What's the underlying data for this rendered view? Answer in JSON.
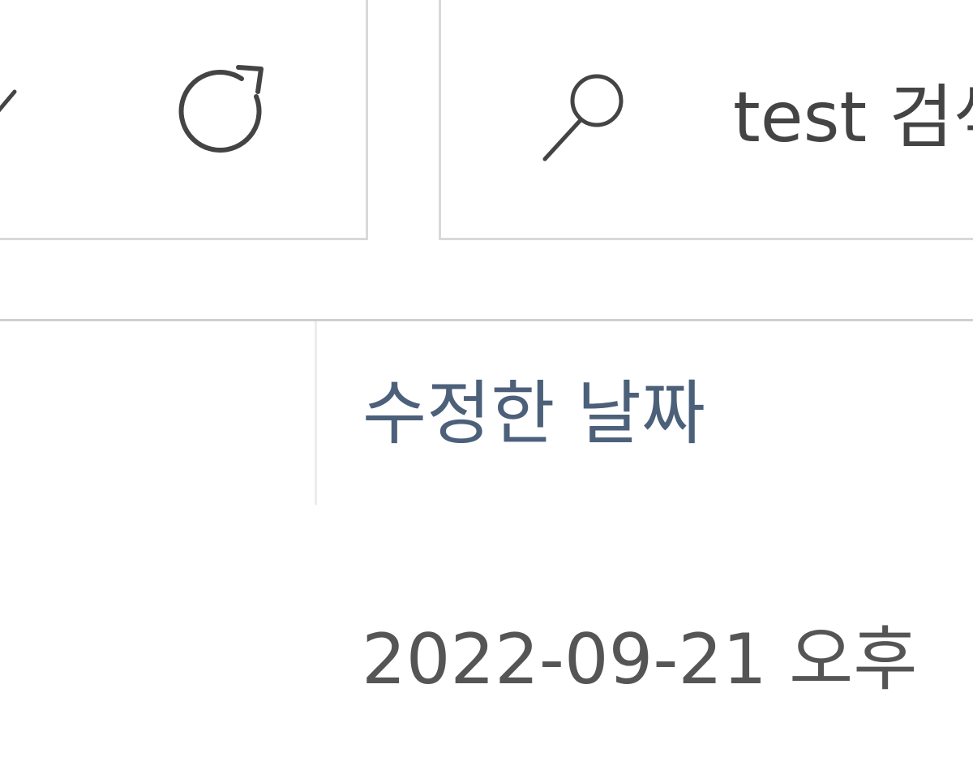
{
  "toolbar": {
    "dropdown_icon": "chevron-down-icon",
    "refresh_icon": "refresh-icon"
  },
  "search": {
    "icon": "search-icon",
    "placeholder": "test 검색"
  },
  "file_list": {
    "columns": [
      {
        "label": "수정한 날짜"
      }
    ],
    "rows": [
      {
        "modified": "2022-09-21 오후"
      }
    ]
  },
  "colors": {
    "border": "#d9d9d9",
    "header_text": "#4c607a",
    "body_text": "#555555"
  }
}
